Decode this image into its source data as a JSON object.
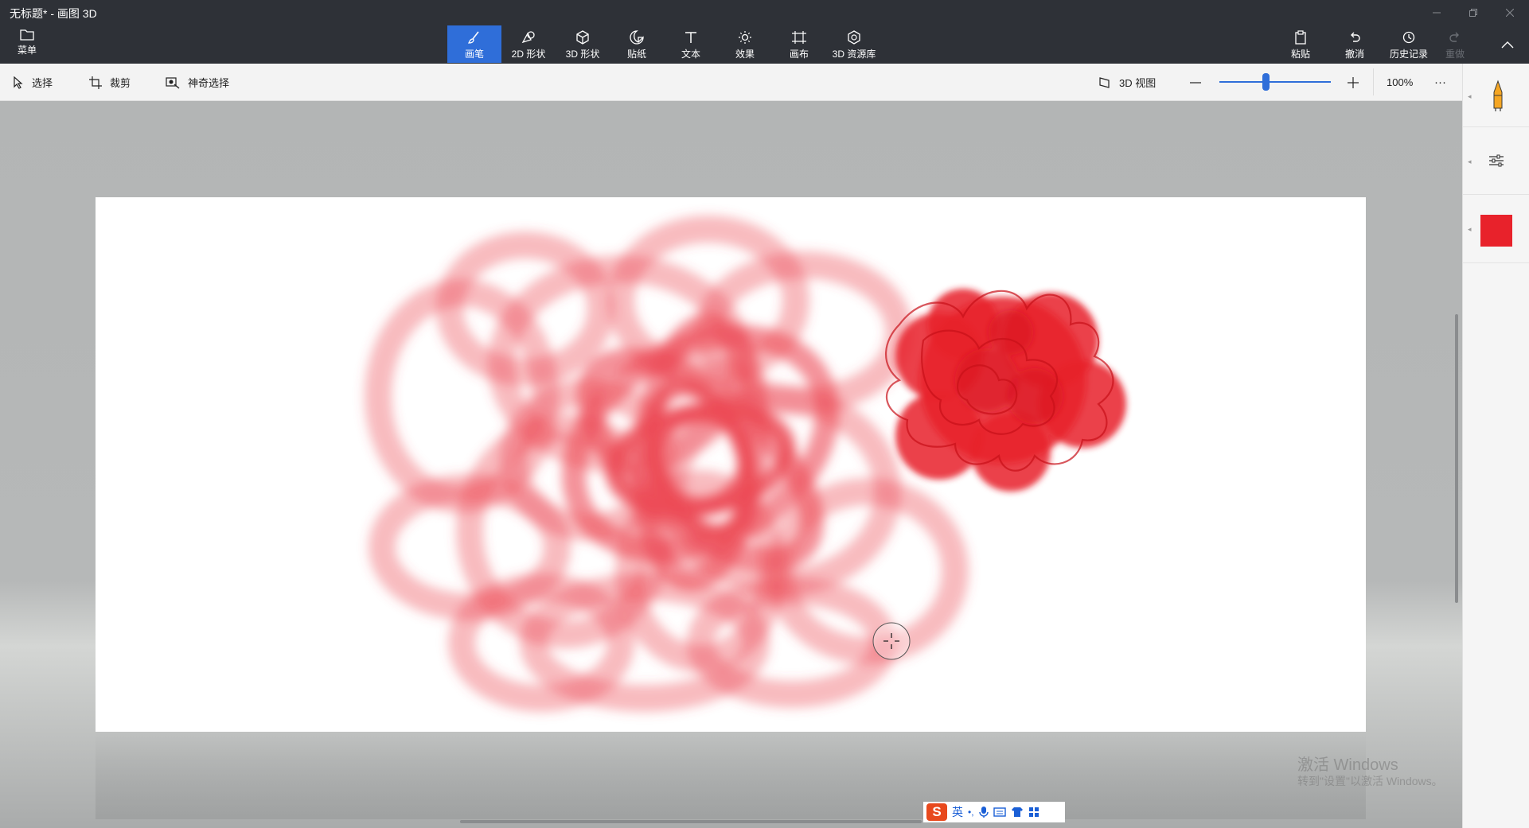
{
  "window": {
    "title": "无标题* - 画图 3D",
    "controls": [
      "minimize-icon",
      "restore-icon",
      "close-icon"
    ]
  },
  "ribbon": {
    "menu_label": "菜单",
    "tools": [
      {
        "label": "画笔",
        "icon": "brush-icon",
        "active": true
      },
      {
        "label": "2D 形状",
        "icon": "shapes-2d-icon",
        "active": false
      },
      {
        "label": "3D 形状",
        "icon": "cube-icon",
        "active": false
      },
      {
        "label": "贴纸",
        "icon": "sticker-icon",
        "active": false
      },
      {
        "label": "文本",
        "icon": "text-icon",
        "active": false
      },
      {
        "label": "效果",
        "icon": "effects-icon",
        "active": false
      },
      {
        "label": "画布",
        "icon": "canvas-icon",
        "active": false
      },
      {
        "label": "3D 资源库",
        "icon": "library-3d-icon",
        "active": false
      }
    ],
    "paste_label": "粘贴",
    "undo_label": "撤消",
    "history_label": "历史记录",
    "redo_label": "重做"
  },
  "toolbar": {
    "select_label": "选择",
    "crop_label": "裁剪",
    "magic_select_label": "神奇选择",
    "view3d_label": "3D 视图",
    "zoom_value": "100%",
    "zoom_level": 0.42,
    "more_label": "···"
  },
  "sidepanel": {
    "tool_icon": "marker-icon",
    "settings_icon": "sliders-icon",
    "selected_color": "#e8222b"
  },
  "colors": {
    "accent": "#2f6ed9",
    "paint": "#e8222b"
  },
  "watermark": {
    "line1": "激活 Windows",
    "line2": "转到\"设置\"以激活 Windows。"
  },
  "ime": {
    "mode_label": "英",
    "punct_label": "•,"
  }
}
